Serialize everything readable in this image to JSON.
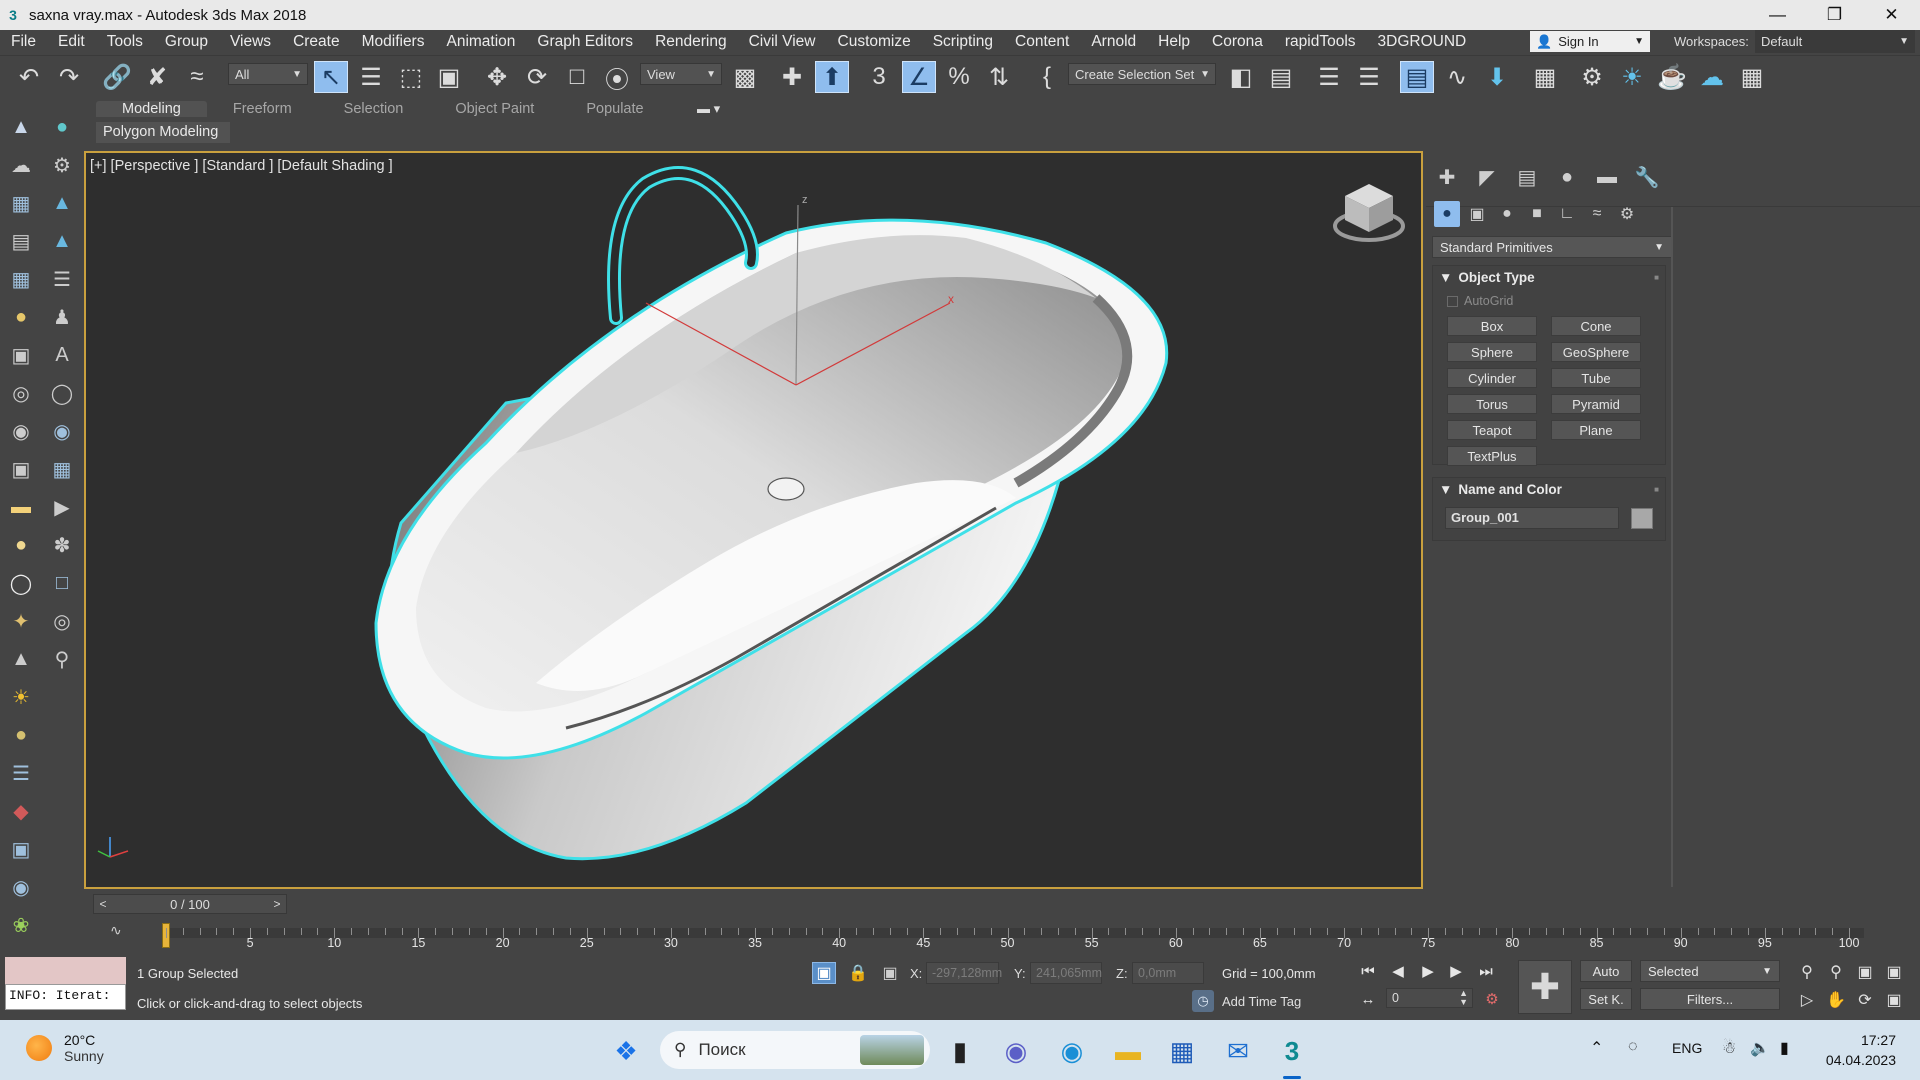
{
  "window": {
    "title": "saxna vray.max - Autodesk 3ds Max 2018",
    "app_icon": "3ds-max-icon"
  },
  "menu": [
    "File",
    "Edit",
    "Tools",
    "Group",
    "Views",
    "Create",
    "Modifiers",
    "Animation",
    "Graph Editors",
    "Rendering",
    "Civil View",
    "Customize",
    "Scripting",
    "Content",
    "Arnold",
    "Help",
    "Corona",
    "rapidTools",
    "3DGROUND"
  ],
  "account": {
    "sign_in": "Sign In",
    "workspaces_label": "Workspaces:",
    "workspace": "Default"
  },
  "toolbar": {
    "selection_filter": "All",
    "ref_coord": "View",
    "selection_set": "Create Selection Set"
  },
  "ribbon": {
    "tabs": [
      "Modeling",
      "Freeform",
      "Selection",
      "Object Paint",
      "Populate"
    ],
    "active": "Modeling",
    "sub_label": "Polygon Modeling"
  },
  "viewport": {
    "label": "[+] [Perspective ] [Standard ] [Default Shading ]",
    "axis_x": "x",
    "axis_z": "z"
  },
  "command_panel": {
    "category": "Standard Primitives",
    "object_type_title": "Object Type",
    "autogrid": "AutoGrid",
    "buttons": [
      "Box",
      "Cone",
      "Sphere",
      "GeoSphere",
      "Cylinder",
      "Tube",
      "Torus",
      "Pyramid",
      "Teapot",
      "Plane",
      "TextPlus"
    ],
    "name_color_title": "Name and Color",
    "object_name": "Group_001",
    "object_color": "#a8a8a8"
  },
  "timeline": {
    "slider": "0 / 100",
    "prev": "<",
    "next": ">",
    "ticks": [
      "5",
      "10",
      "15",
      "20",
      "25",
      "30",
      "35",
      "40",
      "45",
      "50",
      "55",
      "60",
      "65",
      "70",
      "75",
      "80",
      "85",
      "90",
      "95",
      "100"
    ]
  },
  "status": {
    "maxscript_output": "INFO: Iterat:",
    "selection": "1 Group Selected",
    "prompt": "Click or click-and-drag to select objects",
    "x_label": "X:",
    "x_value": "-297,128mm",
    "y_label": "Y:",
    "y_value": "241,065mm",
    "z_label": "Z:",
    "z_value": "0,0mm",
    "grid": "Grid = 100,0mm",
    "add_time_tag": "Add Time Tag",
    "frame": "0",
    "auto": "Auto",
    "set_key": "Set K.",
    "key_filter": "Selected",
    "filters": "Filters..."
  },
  "taskbar": {
    "temp": "20°C",
    "weather": "Sunny",
    "search_placeholder": "Поиск",
    "lang": "ENG",
    "time": "17:27",
    "date": "04.04.2023"
  },
  "colors": {
    "selection_outline": "#3fe0e8",
    "viewport_border": "#c9a03e",
    "active_tool": "#8fbdee"
  }
}
